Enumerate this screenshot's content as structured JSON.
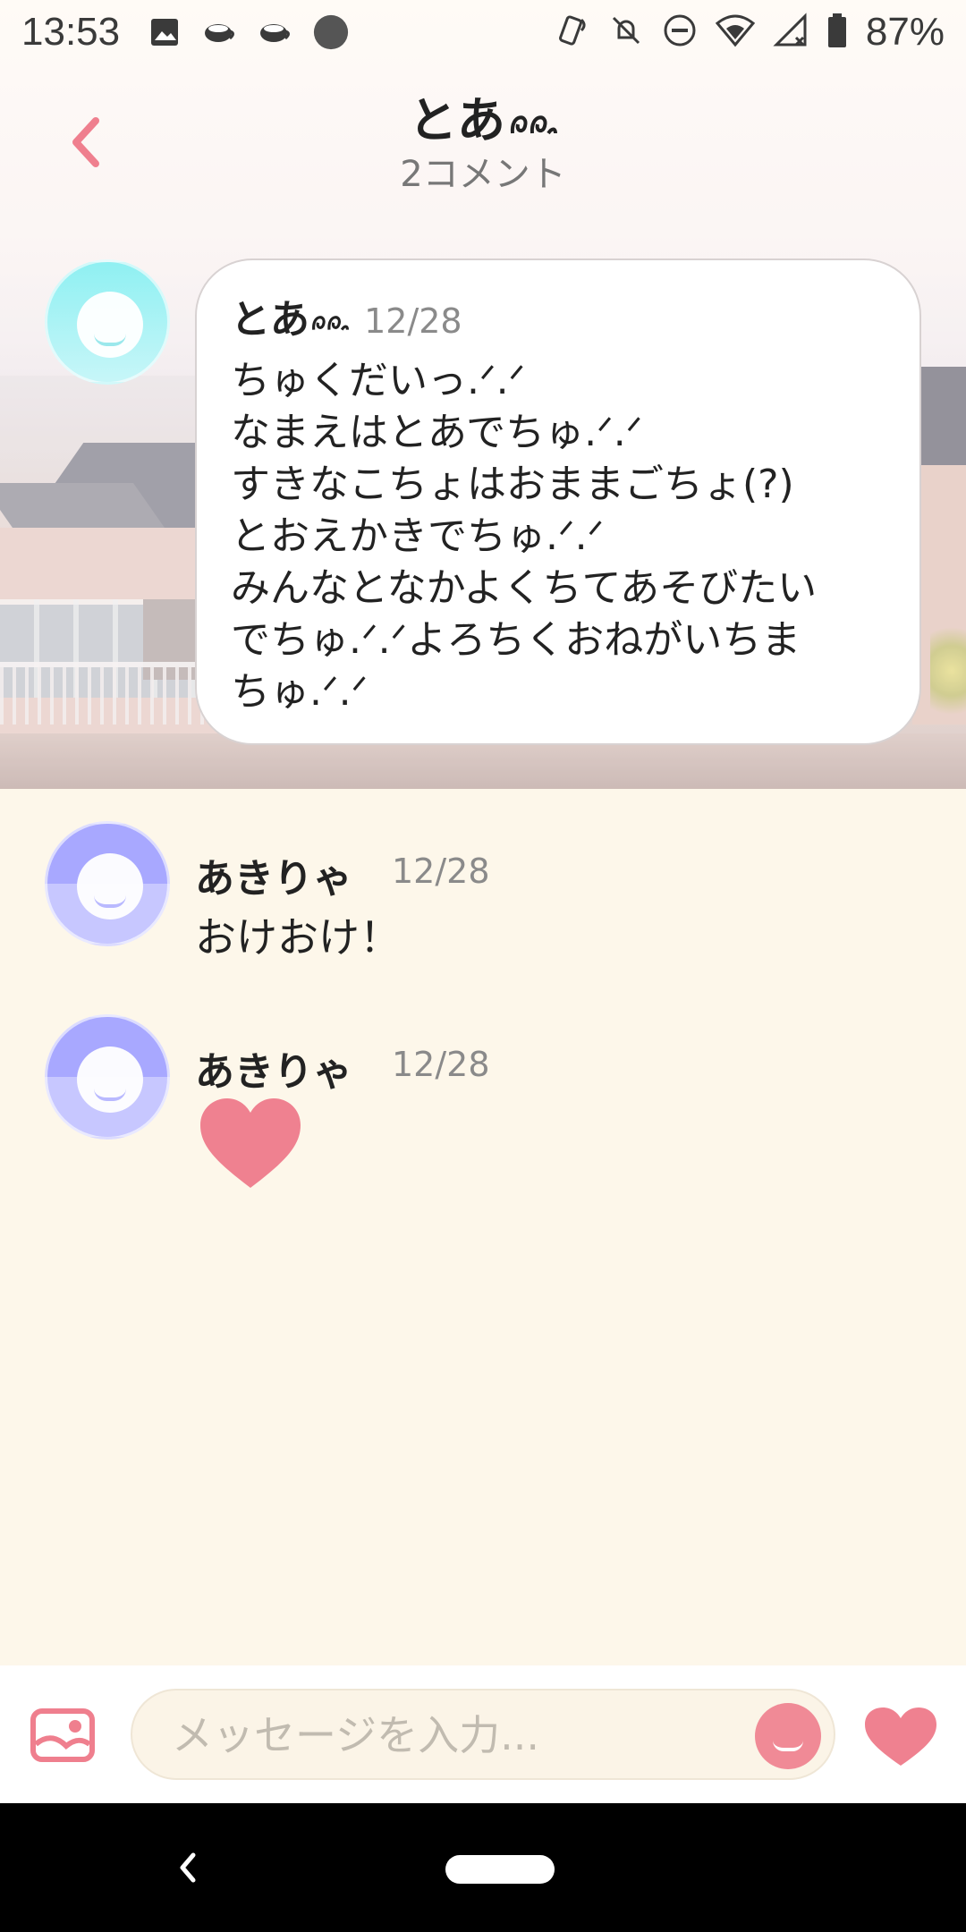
{
  "status_bar": {
    "time": "13:53",
    "battery": "87%",
    "icons": [
      "image-icon",
      "cup-icon",
      "cup-icon",
      "circle-icon",
      "vibrate-icon",
      "bell-off-icon",
      "dnd-icon",
      "wifi-icon",
      "signal-icon",
      "battery-icon"
    ]
  },
  "header": {
    "title": "とあ",
    "subtitle": "2コメント",
    "back_icon": "chevron-left-icon"
  },
  "post": {
    "author": "とあ",
    "date": "12/28",
    "body": "ちゅくだいっ.ᐟ.ᐟ\nなまえはとあでちゅ.ᐟ.ᐟ\nすきなこちょはおままごちょ(?)\nとおえかきでちゅ.ᐟ.ᐟ\nみんなとなかよくちてあそびたい\nでちゅ.ᐟ.ᐟよろちくおねがいちま\nちゅ.ᐟ.ᐟ"
  },
  "comments": [
    {
      "author": "あきりゃ",
      "date": "12/28",
      "text": "おけおけ！"
    },
    {
      "author": "あきりゃ",
      "date": "12/28",
      "reaction": "heart-icon"
    }
  ],
  "input": {
    "placeholder": "メッセージを入力..."
  },
  "colors": {
    "accent": "#f08a96",
    "background": "#fdf7ea"
  }
}
